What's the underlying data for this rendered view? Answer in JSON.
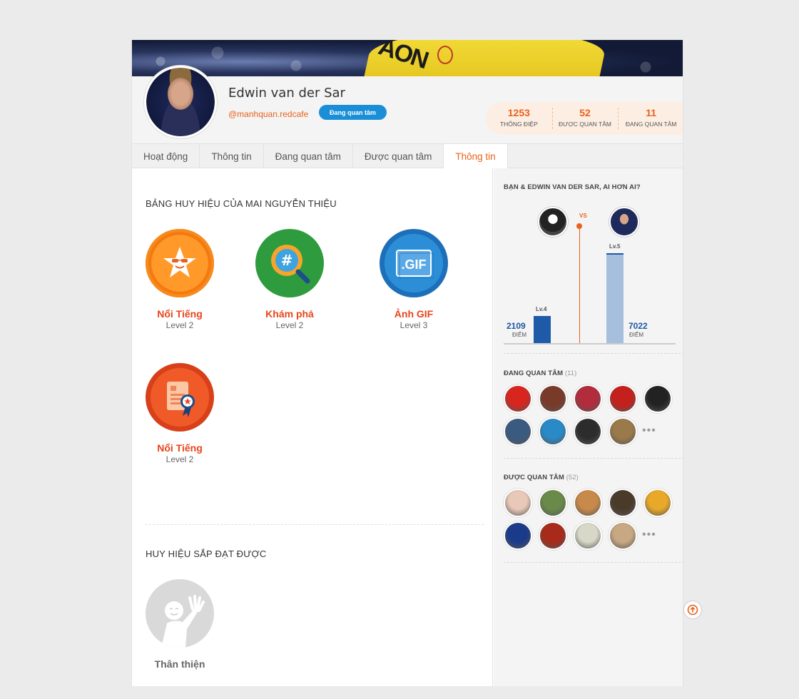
{
  "profile": {
    "name": "Edwin van der Sar",
    "handle": "@manhquan.redcafe",
    "follow_button": "Đang quan tâm",
    "cover_text": "AON",
    "stats": [
      {
        "value": "1253",
        "label": "THÔNG ĐIỆP"
      },
      {
        "value": "52",
        "label": "ĐƯỢC QUAN TÂM"
      },
      {
        "value": "11",
        "label": "ĐANG QUAN TÂM"
      }
    ]
  },
  "tabs": [
    {
      "label": "Hoạt động",
      "active": false
    },
    {
      "label": "Thông tin",
      "active": false
    },
    {
      "label": "Đang quan tâm",
      "active": false
    },
    {
      "label": "Được quan tâm",
      "active": false
    },
    {
      "label": "Thông tin",
      "active": true
    }
  ],
  "badges_section": {
    "title": "BẢNG HUY HIỆU CỦA MAI NGUYỄN THIỆU",
    "badges": [
      {
        "name": "Nổi Tiếng",
        "level": "Level 2",
        "icon": "star-sunglasses-icon"
      },
      {
        "name": "Khám phá",
        "level": "Level 2",
        "icon": "hashtag-magnifier-icon"
      },
      {
        "name": "Ảnh GIF",
        "level": "Level 3",
        "icon": "gif-icon"
      },
      {
        "name": "Nổi Tiếng",
        "level": "Level 2",
        "icon": "certificate-ribbon-icon"
      }
    ]
  },
  "upcoming_section": {
    "title": "HUY HIỆU SẮP ĐẠT ĐƯỢC",
    "badges": [
      {
        "name": "Thân thiện",
        "icon": "waving-person-icon"
      }
    ]
  },
  "compare": {
    "title": "BẠN & EDWIN VAN DER SAR, AI HƠN AI?",
    "vs_label": "VS",
    "left": {
      "points": "2109",
      "points_label": "ĐIỂM",
      "level": "Lv.4",
      "value": 2109
    },
    "right": {
      "points": "7022",
      "points_label": "ĐIỂM",
      "level": "Lv.5",
      "value": 7022
    }
  },
  "following": {
    "title": "ĐANG QUAN TÂM",
    "count": "(11)",
    "more": "•••",
    "avatar_colors": [
      "#d8261f",
      "#7a3a2a",
      "#b22c3c",
      "#c4201c",
      "#222222",
      "#3a5a80",
      "#2a8ac8",
      "#2c2c2c",
      "#9a7a4a"
    ]
  },
  "followers": {
    "title": "ĐƯỢC QUAN TÂM",
    "count": "(52)",
    "more": "•••",
    "avatar_colors": [
      "#e8c8b8",
      "#6a8a4a",
      "#c88a4a",
      "#4a3a2a",
      "#e8a82a",
      "#1a3a8a",
      "#a82a1a",
      "#d8d8c8",
      "#c8a882"
    ]
  }
}
